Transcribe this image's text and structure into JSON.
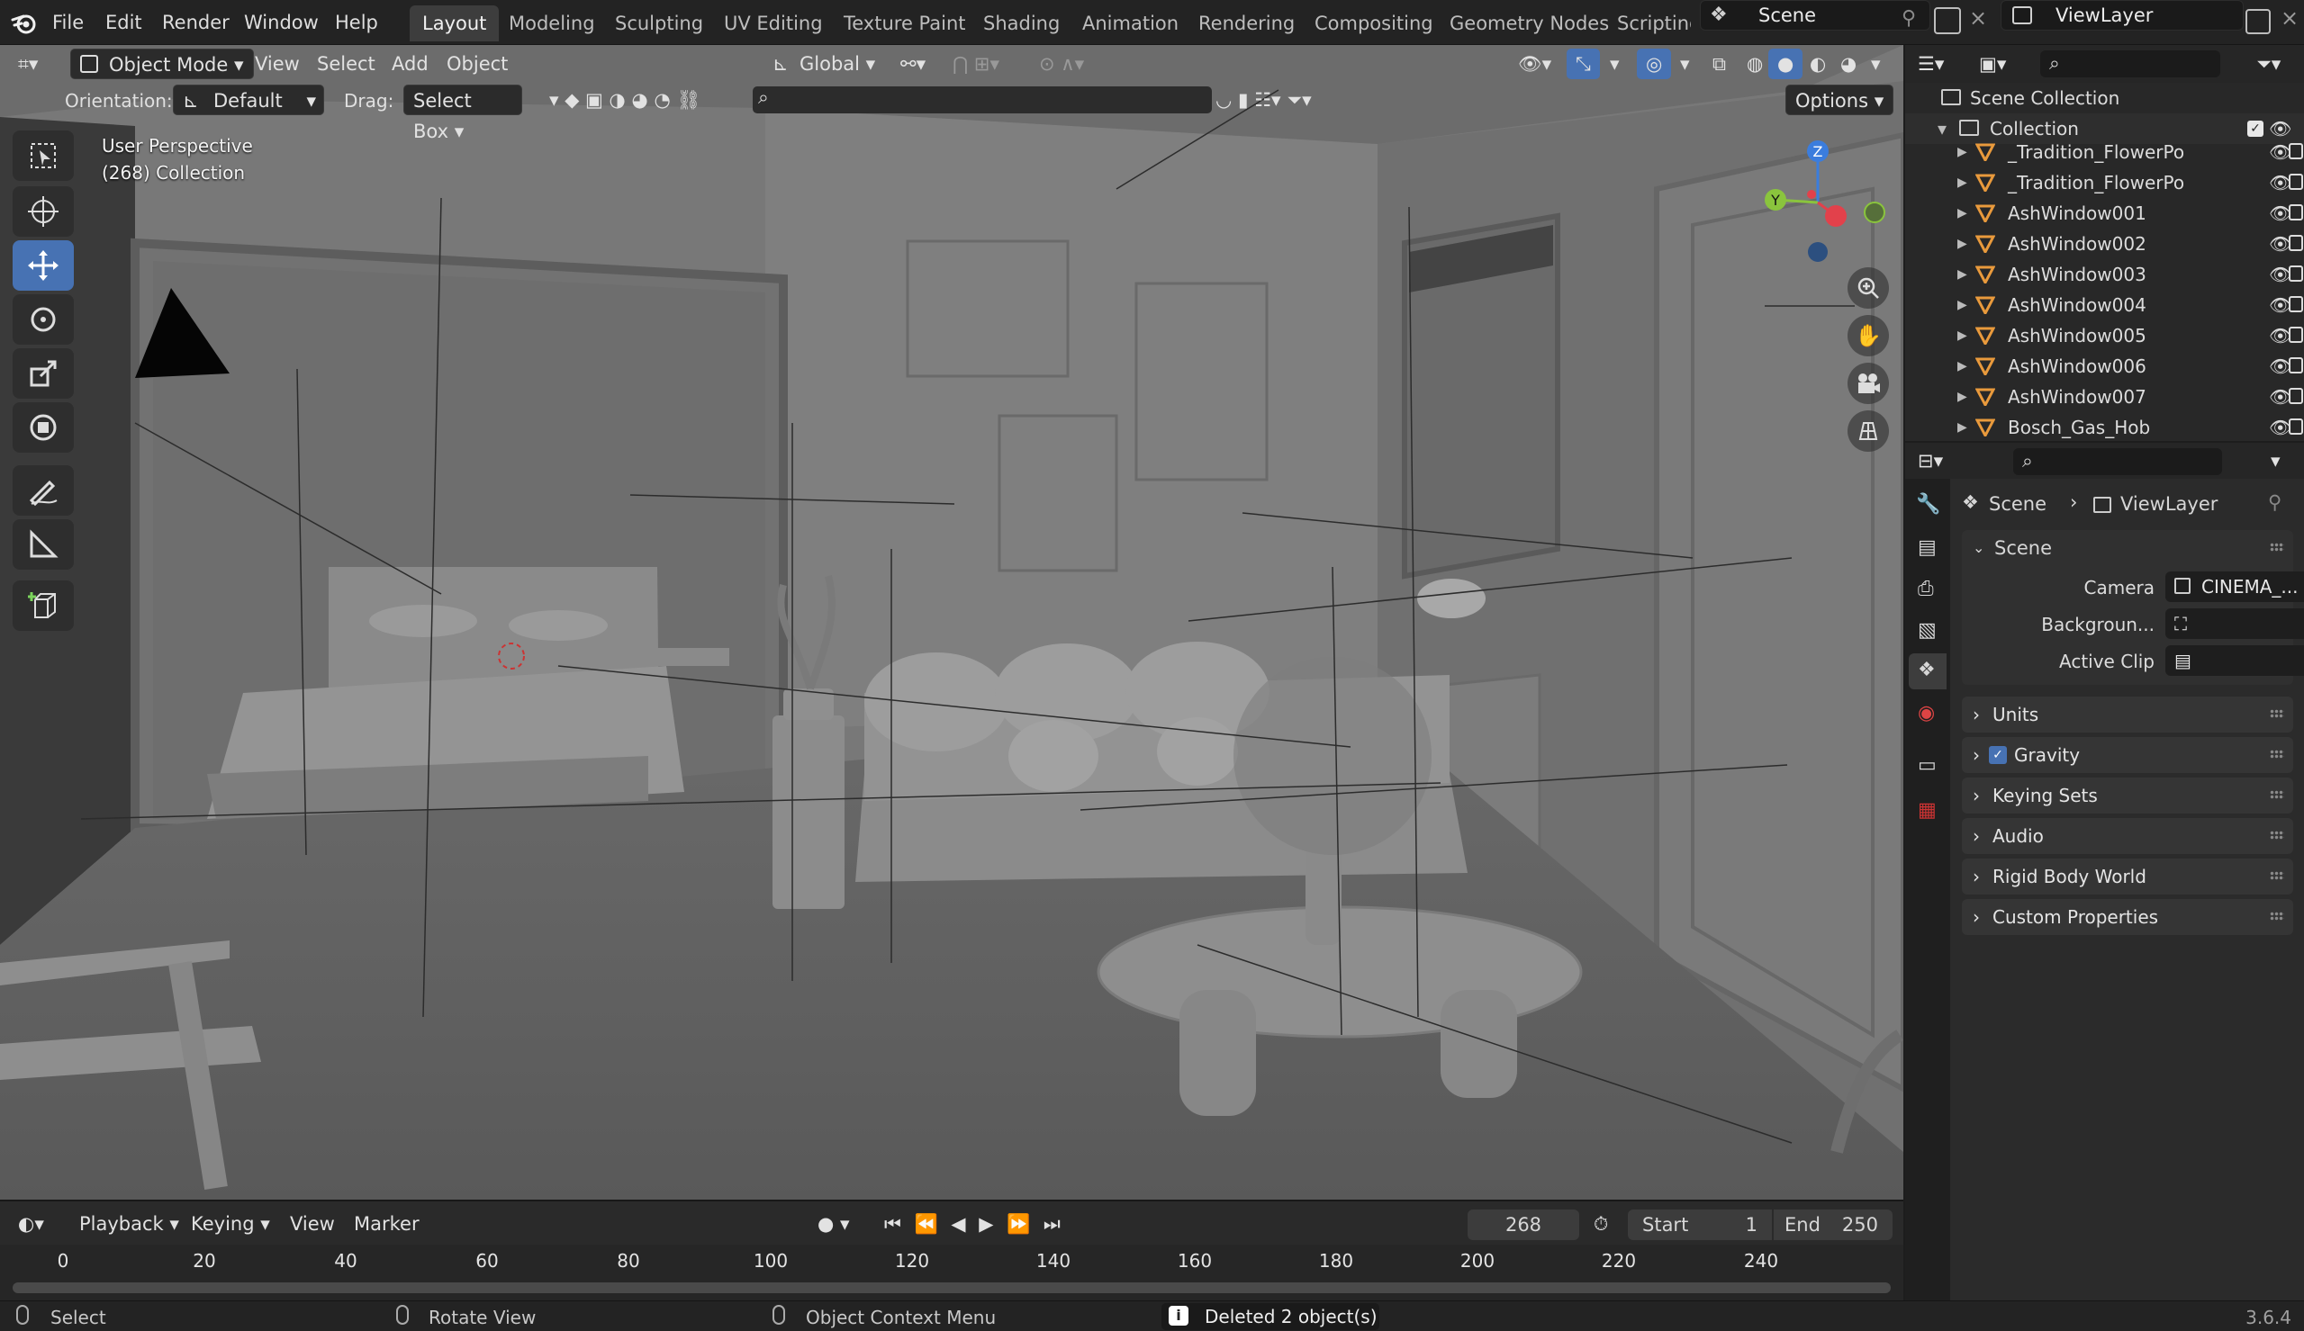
{
  "menu": [
    "File",
    "Edit",
    "Render",
    "Window",
    "Help"
  ],
  "workspaces": [
    "Layout",
    "Modeling",
    "Sculpting",
    "UV Editing",
    "Texture Paint",
    "Shading",
    "Animation",
    "Rendering",
    "Compositing",
    "Geometry Nodes",
    "Scripting"
  ],
  "active_workspace": "Layout",
  "scene_field": "Scene",
  "viewlayer_field": "ViewLayer",
  "viewport_header": {
    "mode": "Object Mode",
    "menus": [
      "View",
      "Select",
      "Add",
      "Object"
    ],
    "transform_orientation": "Global",
    "orientation_label": "Orientation:",
    "orientation_value": "Default",
    "drag_label": "Drag:",
    "drag_value": "Select Box",
    "options": "Options"
  },
  "viewport_overlay": {
    "line1": "User Perspective",
    "line2": "(268) Collection",
    "gizmo": {
      "z": "Z",
      "y": "Y"
    }
  },
  "timeline": {
    "menus": [
      "Playback",
      "Keying",
      "View",
      "Marker"
    ],
    "current_frame": "268",
    "start_label": "Start",
    "start": "1",
    "end_label": "End",
    "end": "250",
    "ruler": [
      "0",
      "20",
      "40",
      "60",
      "80",
      "100",
      "120",
      "140",
      "160",
      "180",
      "200",
      "220",
      "240"
    ]
  },
  "status": {
    "select": "Select",
    "rotate": "Rotate View",
    "context": "Object Context Menu",
    "message": "Deleted 2 object(s)",
    "version": "3.6.4"
  },
  "outliner": {
    "root": "Scene Collection",
    "collection": "Collection",
    "items": [
      "_Tradition_FlowerPo",
      "_Tradition_FlowerPo",
      "AshWindow001",
      "AshWindow002",
      "AshWindow003",
      "AshWindow004",
      "AshWindow005",
      "AshWindow006",
      "AshWindow007",
      "Bosch_Gas_Hob"
    ]
  },
  "properties": {
    "breadcrumb_scene": "Scene",
    "breadcrumb_layer": "ViewLayer",
    "scene_panel": "Scene",
    "camera_label": "Camera",
    "camera_value": "CINEMA_...",
    "background_label": "Backgroun...",
    "active_clip_label": "Active Clip",
    "panels": [
      "Units",
      "Gravity",
      "Keying Sets",
      "Audio",
      "Rigid Body World",
      "Custom Properties"
    ]
  },
  "colors": {
    "accent": "#4772b3",
    "x_axis": "#e2414b",
    "y_axis": "#8ac43d",
    "z_axis": "#3b7ddd"
  }
}
